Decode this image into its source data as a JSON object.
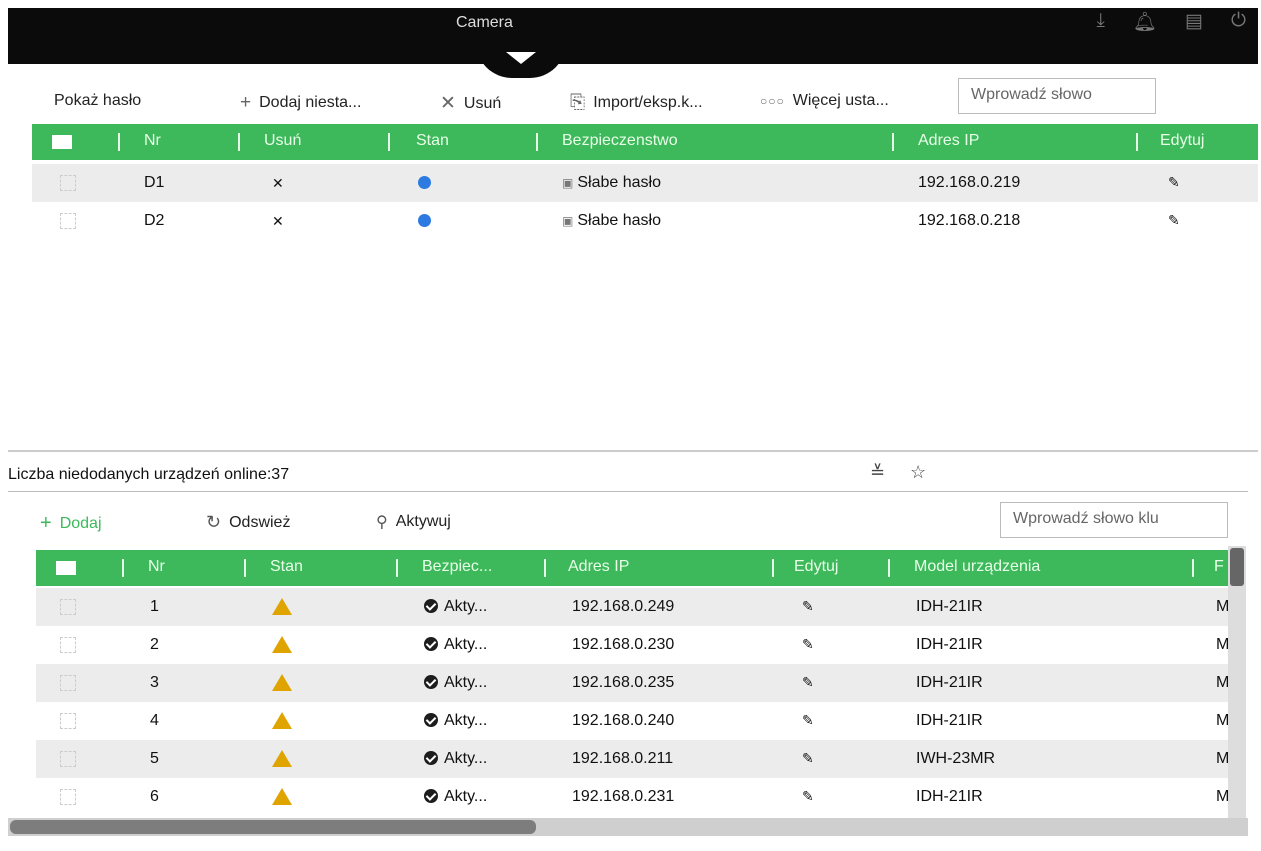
{
  "window": {
    "title": "Camera"
  },
  "topbar_icons": [
    "download-icon",
    "bell-icon",
    "task-icon",
    "power-icon"
  ],
  "toolbar": {
    "show_password": "Pokaż hasło",
    "add_custom": "Dodaj niesta...",
    "delete": "Usuń",
    "import_export": "Import/eksp.k...",
    "more_settings": "Więcej usta...",
    "search_placeholder": "Wprowadź słowo"
  },
  "added_table": {
    "headers": [
      "Nr",
      "Usuń",
      "Stan",
      "Bezpieczenstwo",
      "Adres IP",
      "Edytuj"
    ],
    "rows": [
      {
        "nr": "D1",
        "security": "Słabe hasło",
        "ip": "192.168.0.219"
      },
      {
        "nr": "D2",
        "security": "Słabe hasło",
        "ip": "192.168.0.218"
      }
    ]
  },
  "online": {
    "count_label": "Liczba niedodanych urządzeń online:37",
    "add": "Dodaj",
    "refresh": "Odswież",
    "activate": "Aktywuj",
    "search_placeholder": "Wprowadź słowo klu"
  },
  "online_table": {
    "headers": [
      "Nr",
      "Stan",
      "Bezpiec...",
      "Adres IP",
      "Edytuj",
      "Model urządzenia",
      "F"
    ],
    "rows": [
      {
        "nr": "1",
        "security": "Akty...",
        "ip": "192.168.0.249",
        "model": "IDH-21IR",
        "extra": "M"
      },
      {
        "nr": "2",
        "security": "Akty...",
        "ip": "192.168.0.230",
        "model": "IDH-21IR",
        "extra": "M"
      },
      {
        "nr": "3",
        "security": "Akty...",
        "ip": "192.168.0.235",
        "model": "IDH-21IR",
        "extra": "M"
      },
      {
        "nr": "4",
        "security": "Akty...",
        "ip": "192.168.0.240",
        "model": "IDH-21IR",
        "extra": "M"
      },
      {
        "nr": "5",
        "security": "Akty...",
        "ip": "192.168.0.211",
        "model": "IWH-23MR",
        "extra": "M"
      },
      {
        "nr": "6",
        "security": "Akty...",
        "ip": "192.168.0.231",
        "model": "IDH-21IR",
        "extra": "M"
      }
    ]
  },
  "colors": {
    "header_green": "#3db85b",
    "warning": "#e0a400",
    "online_blue": "#2d7be0"
  }
}
